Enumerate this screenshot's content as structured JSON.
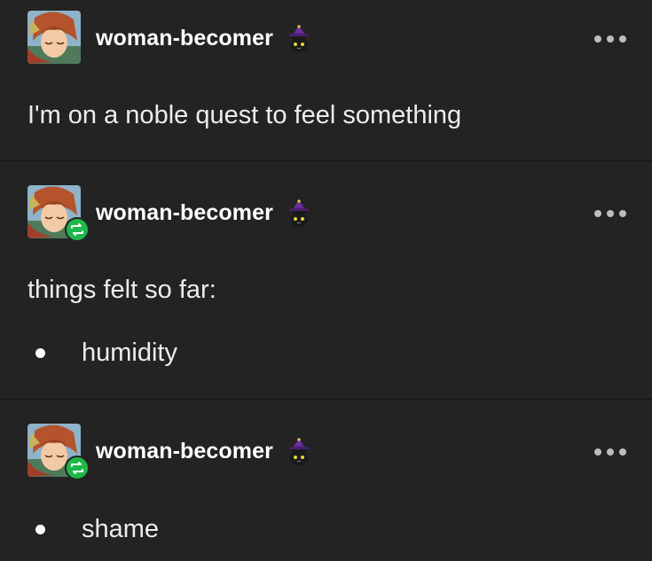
{
  "posts": [
    {
      "username": "woman-becomer",
      "reblog": false,
      "text": "I'm on a noble quest to feel something",
      "list": []
    },
    {
      "username": "woman-becomer",
      "reblog": true,
      "text": "things felt so far:",
      "list": [
        "humidity"
      ]
    },
    {
      "username": "woman-becomer",
      "reblog": true,
      "text": "",
      "list": [
        "shame"
      ]
    }
  ],
  "icons": {
    "avatar": "avatar-icon",
    "badge": "witch-cat-badge-icon",
    "reblog": "reblog-icon",
    "more": "more-options-icon"
  },
  "colors": {
    "background": "#232323",
    "divider": "#141414",
    "reblog_green": "#1fb84a",
    "text": "#ededed"
  }
}
